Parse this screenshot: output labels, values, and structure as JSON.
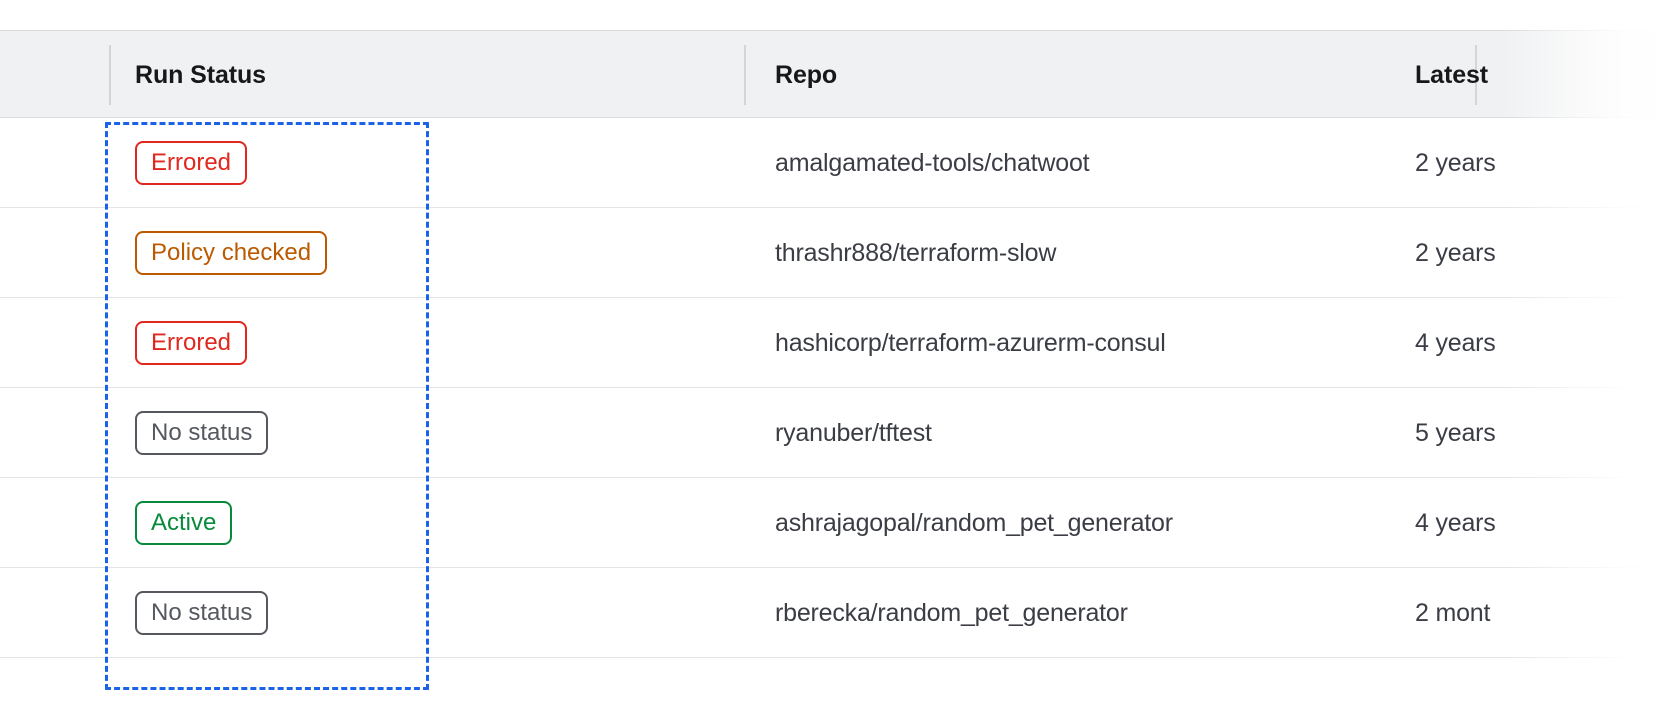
{
  "table": {
    "columns": [
      {
        "key": "run_status",
        "label": "Run Status"
      },
      {
        "key": "repo",
        "label": "Repo"
      },
      {
        "key": "latest",
        "label": "Latest"
      }
    ],
    "rows": [
      {
        "status": "Errored",
        "status_kind": "errored",
        "repo": "amalgamated-tools/chatwoot",
        "latest": "2 years"
      },
      {
        "status": "Policy checked",
        "status_kind": "policy",
        "repo": "thrashr888/terraform-slow",
        "latest": "2 years"
      },
      {
        "status": "Errored",
        "status_kind": "errored",
        "repo": "hashicorp/terraform-azurerm-consul",
        "latest": "4 years"
      },
      {
        "status": "No status",
        "status_kind": "none",
        "repo": "ryanuber/tftest",
        "latest": "5 years"
      },
      {
        "status": "Active",
        "status_kind": "active",
        "repo": "ashrajagopal/random_pet_generator",
        "latest": "4 years"
      },
      {
        "status": "No status",
        "status_kind": "none",
        "repo": "rberecka/random_pet_generator",
        "latest": "2 mont"
      }
    ]
  },
  "colors": {
    "errored": "#e0281e",
    "policy_checked": "#bb5a00",
    "no_status": "#55585f",
    "active": "#088a3c",
    "header_background": "#f0f1f3",
    "annotation_outline": "#1a62e8",
    "row_divider": "#e3e4e7",
    "text_primary": "#17181a",
    "text_secondary": "#3b3d45"
  },
  "annotation": {
    "target_column": "Run Status",
    "style": "dashed-rectangle"
  }
}
